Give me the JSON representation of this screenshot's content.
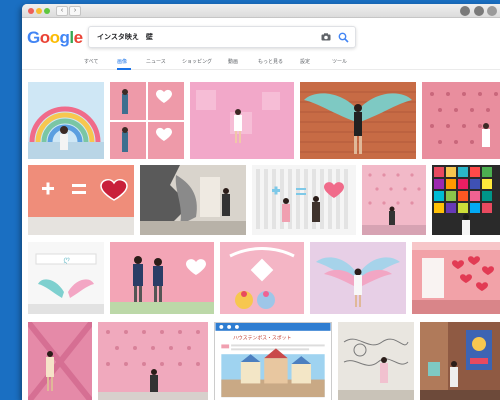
{
  "browser": {
    "back_glyph": "‹",
    "forward_glyph": "›",
    "icons": [
      "close-icon",
      "minimize-icon",
      "maximize-icon",
      "back-icon",
      "forward-icon",
      "profile-icon",
      "share-icon",
      "extension-icon"
    ]
  },
  "google": {
    "logo_letters": [
      {
        "ch": "G",
        "color": "#4285F4"
      },
      {
        "ch": "o",
        "color": "#EA4335"
      },
      {
        "ch": "o",
        "color": "#FBBC05"
      },
      {
        "ch": "g",
        "color": "#4285F4"
      },
      {
        "ch": "l",
        "color": "#34A853"
      },
      {
        "ch": "e",
        "color": "#EA4335"
      }
    ],
    "search_query": "インスタ映え　壁",
    "tabs": [
      {
        "label": "すべて",
        "active": false
      },
      {
        "label": "画像",
        "active": true
      },
      {
        "label": "ニュース",
        "active": false
      },
      {
        "label": "ショッピング",
        "active": false
      },
      {
        "label": "動画",
        "active": false
      },
      {
        "label": "もっと見る",
        "active": false
      },
      {
        "label": "設定",
        "active": false
      },
      {
        "label": "ツール",
        "active": false
      }
    ],
    "accent_color": "#1a73e8"
  },
  "results": {
    "images": [
      {
        "name": "rainbow-wall-image"
      },
      {
        "name": "heart-wall-collage-image"
      },
      {
        "name": "pink-tile-wall-image"
      },
      {
        "name": "angel-wings-brick-wall-image"
      },
      {
        "name": "pink-dot-wall-image-1"
      },
      {
        "name": "plus-equals-heart-wall-image"
      },
      {
        "name": "ink-mural-wall-image"
      },
      {
        "name": "white-fence-heart-image"
      },
      {
        "name": "pink-dot-wall-image-2"
      },
      {
        "name": "colorful-mosaic-wall-image"
      },
      {
        "name": "wings-neon-sign-image"
      },
      {
        "name": "couple-pink-heart-wall-image"
      },
      {
        "name": "pink-cafe-sign-image"
      },
      {
        "name": "pastel-wings-wall-image"
      },
      {
        "name": "pink-room-hearts-image"
      },
      {
        "name": "pink-wall-girl-image"
      },
      {
        "name": "pink-dot-street-image"
      },
      {
        "name": "theme-park-webpage-image"
      },
      {
        "name": "sketch-wall-image"
      },
      {
        "name": "graffiti-street-image"
      }
    ],
    "webpage_thumbnail_title": "ハウステンボス・スポット"
  }
}
